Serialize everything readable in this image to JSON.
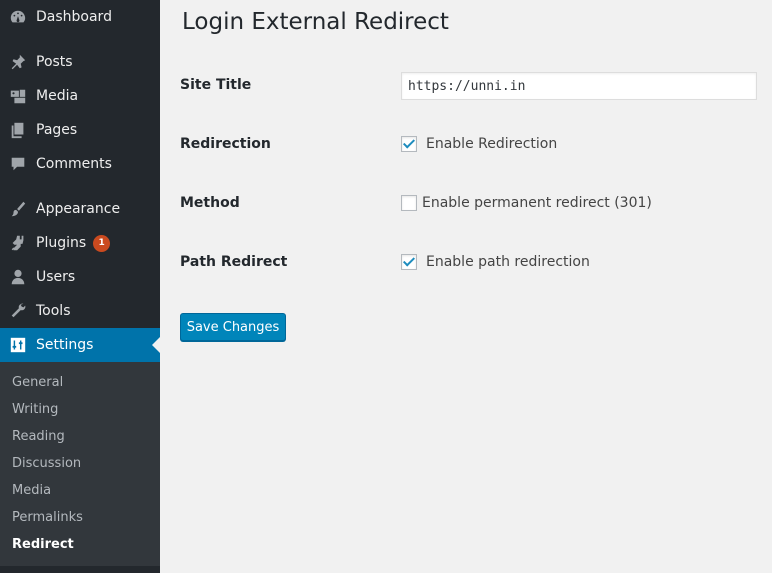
{
  "sidebar": {
    "items": [
      {
        "label": "Dashboard",
        "icon": "dashboard-icon"
      },
      {
        "label": "Posts",
        "icon": "pin-icon"
      },
      {
        "label": "Media",
        "icon": "media-icon"
      },
      {
        "label": "Pages",
        "icon": "pages-icon"
      },
      {
        "label": "Comments",
        "icon": "comment-icon"
      },
      {
        "label": "Appearance",
        "icon": "paintbrush-icon"
      },
      {
        "label": "Plugins",
        "icon": "plugin-icon",
        "badge": "1"
      },
      {
        "label": "Users",
        "icon": "user-icon"
      },
      {
        "label": "Tools",
        "icon": "wrench-icon"
      },
      {
        "label": "Settings",
        "icon": "settings-icon",
        "active": true
      }
    ],
    "submenu": [
      "General",
      "Writing",
      "Reading",
      "Discussion",
      "Media",
      "Permalinks",
      "Redirect"
    ],
    "current_sub": "Redirect"
  },
  "page": {
    "title": "Login External Redirect"
  },
  "form": {
    "site_title_label": "Site Title",
    "site_title_value": "https://unni.in",
    "redirection_label": "Redirection",
    "redirection_option": "Enable Redirection",
    "redirection_checked": true,
    "method_label": "Method",
    "method_option": "Enable permanent redirect (301)",
    "method_checked": false,
    "path_label": "Path Redirect",
    "path_option": "Enable path redirection",
    "path_checked": true,
    "save_label": "Save Changes"
  },
  "colors": {
    "sidebar_bg": "#23282d",
    "active_bg": "#0073aa",
    "button_bg": "#0085ba",
    "badge_bg": "#ca4a1f"
  }
}
